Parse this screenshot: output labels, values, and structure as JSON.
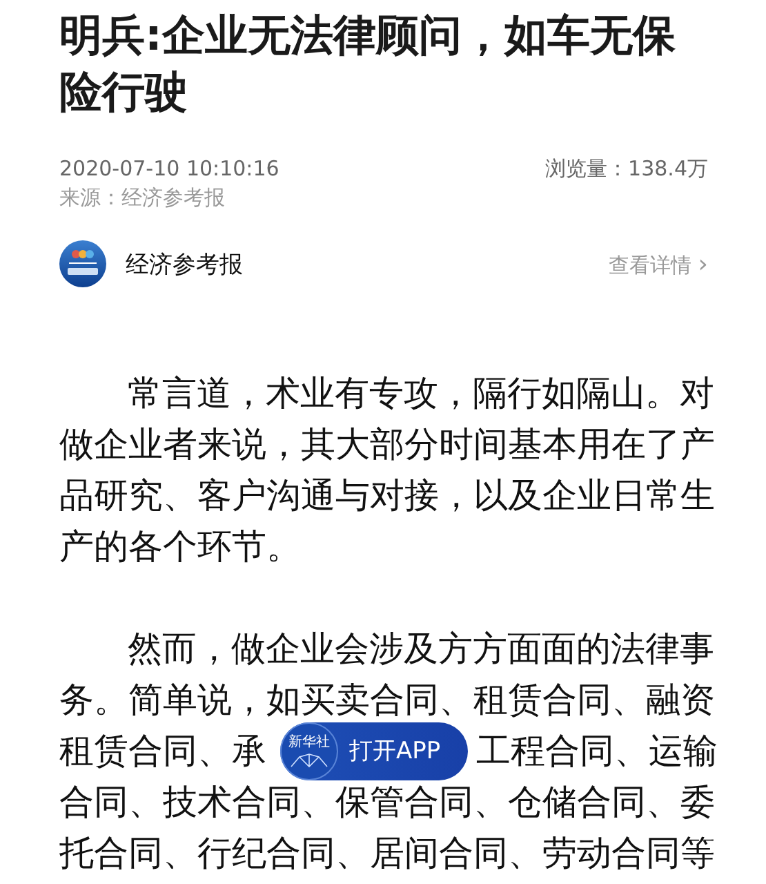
{
  "article": {
    "title": "明兵:企业无法律顾问，如车无保险行驶",
    "date": "2020-07-10 10:10:16",
    "views": "浏览量：138.4万",
    "source": "来源：经济参考报"
  },
  "author": {
    "name": "经济参考报",
    "details_link": "查看详情",
    "chevron": "›"
  },
  "paragraphs": [
    {
      "lines": [
        {
          "text": "常言道，术业有专攻，隔行如隔山。对"
        },
        {
          "text": "做企业者来说，其大部分时间基本用在了产"
        },
        {
          "text": "品研究、客户沟通与对接，以及企业日常生"
        },
        {
          "text": "产的各个环节。"
        }
      ]
    },
    {
      "lines": [
        {
          "text": "然而，做企业会涉及方方面面的法律事"
        },
        {
          "text": "务。简单说，如买卖合同、租赁合同、融资"
        },
        {
          "text": "租赁合同、承",
          "after": "工程合同、运输"
        },
        {
          "text": "合同、技术合同、保管合同、仓储合同、委"
        },
        {
          "text": "托合同、行纪合同、居间合同、劳动合同等"
        }
      ]
    }
  ],
  "open_app_button": {
    "logo_text": "新华社",
    "label": "打开APP"
  }
}
